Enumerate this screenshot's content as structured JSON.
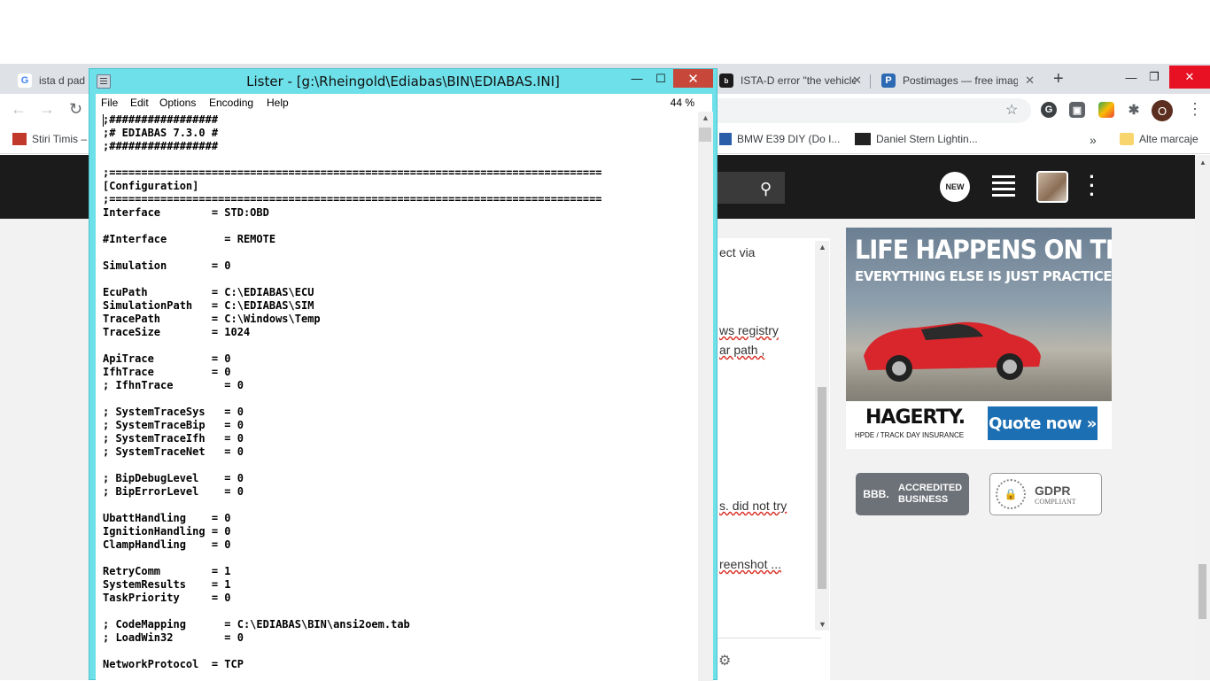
{
  "browser": {
    "tabs": [
      {
        "label": "ista d pad",
        "favicon": "G",
        "color": "#4285f4"
      },
      {
        "label": "ISTA-D error \"the vehicle",
        "favicon": "bimmerpost",
        "color": "#1b1b1b"
      },
      {
        "label": "Postimages — free imag",
        "favicon": "P",
        "color": "#2d6ab4"
      }
    ],
    "bookmarks": [
      {
        "label": "Stiri Timis –"
      },
      {
        "label": "BMW E39 DIY (Do I..."
      },
      {
        "label": "Daniel Stern Lightin..."
      },
      {
        "label": "Alte marcaje"
      }
    ],
    "more_bookmarks": "»",
    "profile_initial": "O",
    "new_tab": "+",
    "star_icon": "star-icon"
  },
  "site": {
    "new_badge": "NEW",
    "post_fragments": [
      {
        "text": "ect via",
        "underline": false
      },
      {
        "text": "ws registry",
        "underline": true
      },
      {
        "text": "ar path ,",
        "underline": true
      },
      {
        "text": "s. did not try",
        "underline": true
      },
      {
        "text": "reenshot ...",
        "underline": true
      }
    ]
  },
  "ad": {
    "headline": "LIFE HAPPENS ON TRACK DAY.",
    "subline": "EVERYTHING ELSE IS JUST PRACTICE.",
    "brand": "HAGERTY.",
    "brand_sub": "HPDE / TRACK DAY INSURANCE",
    "cta": "Quote now »"
  },
  "badges": {
    "bbb_logo": "BBB.",
    "bbb_text_1": "ACCREDITED",
    "bbb_text_2": "BUSINESS",
    "gdpr_title": "GDPR",
    "gdpr_sub": "COMPLIANT"
  },
  "lister": {
    "title": "Lister - [g:\\Rheingold\\Ediabas\\BIN\\EDIABAS.INI]",
    "minimize": "—",
    "maximize": "☐",
    "close": "✕",
    "menu": [
      "File",
      "Edit",
      "Options",
      "Encoding",
      "Help"
    ],
    "zoom": "44 %",
    "content": ";#################\n;# EDIABAS 7.3.0 #\n;#################\n\n;=============================================================================\n[Configuration]\n;=============================================================================\nInterface        = STD:OBD\n\n#Interface         = REMOTE\n\nSimulation       = 0\n\nEcuPath          = C:\\EDIABAS\\ECU\nSimulationPath   = C:\\EDIABAS\\SIM\nTracePath        = C:\\Windows\\Temp\nTraceSize        = 1024\n\nApiTrace         = 0\nIfhTrace         = 0\n; IfhnTrace        = 0\n\n; SystemTraceSys   = 0\n; SystemTraceBip   = 0\n; SystemTraceIfh   = 0\n; SystemTraceNet   = 0\n\n; BipDebugLevel    = 0\n; BipErrorLevel    = 0\n\nUbattHandling    = 0\nIgnitionHandling = 0\nClampHandling    = 0\n\nRetryComm        = 1\nSystemResults    = 1\nTaskPriority     = 0\n\n; CodeMapping      = C:\\EDIABAS\\BIN\\ansi2oem.tab\n; LoadWin32        = 0\n\nNetworkProtocol  = TCP"
  }
}
